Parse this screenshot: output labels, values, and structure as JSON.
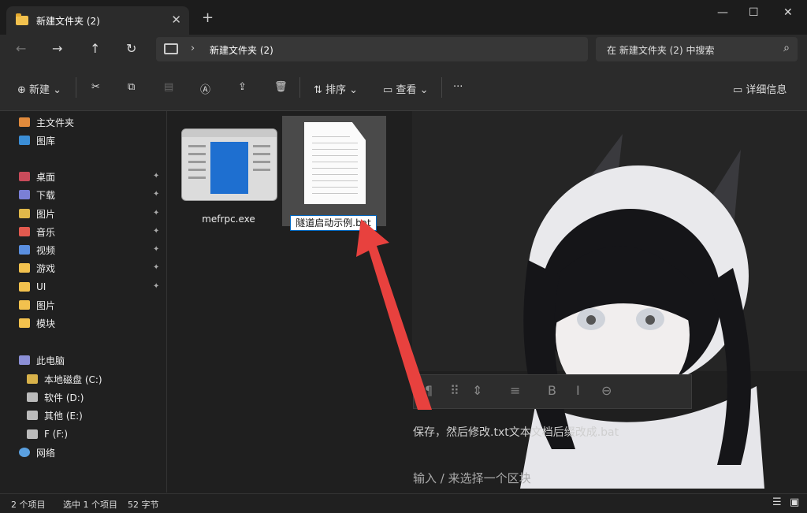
{
  "window": {
    "tab_title": "新建文件夹 (2)",
    "new_tab": "+",
    "minimize": "—",
    "maximize": "☐",
    "close": "✕"
  },
  "nav": {
    "back": "←",
    "forward": "→",
    "up": "↑",
    "refresh": "↻",
    "path_chevron": "›",
    "path": "新建文件夹 (2)",
    "search_placeholder": "在 新建文件夹 (2) 中搜索",
    "search_icon": "search-icon"
  },
  "toolbar": {
    "new_label": "新建",
    "sort_label": "排序",
    "view_label": "查看",
    "more": "···",
    "details_label": "详细信息"
  },
  "sidebar": {
    "items": [
      {
        "label": "主文件夹",
        "color": "#e08a3c"
      },
      {
        "label": "图库",
        "color": "#3b8ed6"
      },
      {
        "label": "桌面",
        "color": "#c84b5a",
        "pinned": true
      },
      {
        "label": "下载",
        "color": "#7a7fd6",
        "pinned": true
      },
      {
        "label": "图片",
        "color": "#e0b84a",
        "pinned": true
      },
      {
        "label": "音乐",
        "color": "#e25a4f",
        "pinned": true
      },
      {
        "label": "视频",
        "color": "#5a8fe0",
        "pinned": true
      },
      {
        "label": "游戏",
        "color": "#f2c14e",
        "pinned": true
      },
      {
        "label": "UI",
        "color": "#f2c14e",
        "pinned": true
      },
      {
        "label": "图片",
        "color": "#f2c14e"
      },
      {
        "label": "模块",
        "color": "#f2c14e"
      },
      {
        "label": "此电脑",
        "color": "#8b8fd6"
      },
      {
        "label": "本地磁盘 (C:)",
        "color": "#d8b24a"
      },
      {
        "label": "软件 (D:)",
        "color": "#bbbbbb"
      },
      {
        "label": "其他 (E:)",
        "color": "#bbbbbb"
      },
      {
        "label": "F (F:)",
        "color": "#bbbbbb"
      },
      {
        "label": "网络",
        "color": "#5aa0e0"
      }
    ],
    "pin_glyph": "📌"
  },
  "files": [
    {
      "name": "mefrpc.exe"
    },
    {
      "name": "隧道启动示例.bat",
      "renaming": true
    }
  ],
  "overlay": {
    "hint_line1": "保存，然后修改.txt文本文档后缀改成.bat",
    "hint_line2": "输入 / 来选择一个区块",
    "bar_glyphs": [
      "¶",
      "⠿",
      "⇕",
      "≡",
      "B",
      "I",
      "⊖"
    ]
  },
  "status": {
    "items_count": "2 个项目",
    "selected": "选中 1 个项目",
    "size": "52 字节"
  },
  "colors": {
    "accent": "#0067c0",
    "arrow": "#e8413e"
  }
}
